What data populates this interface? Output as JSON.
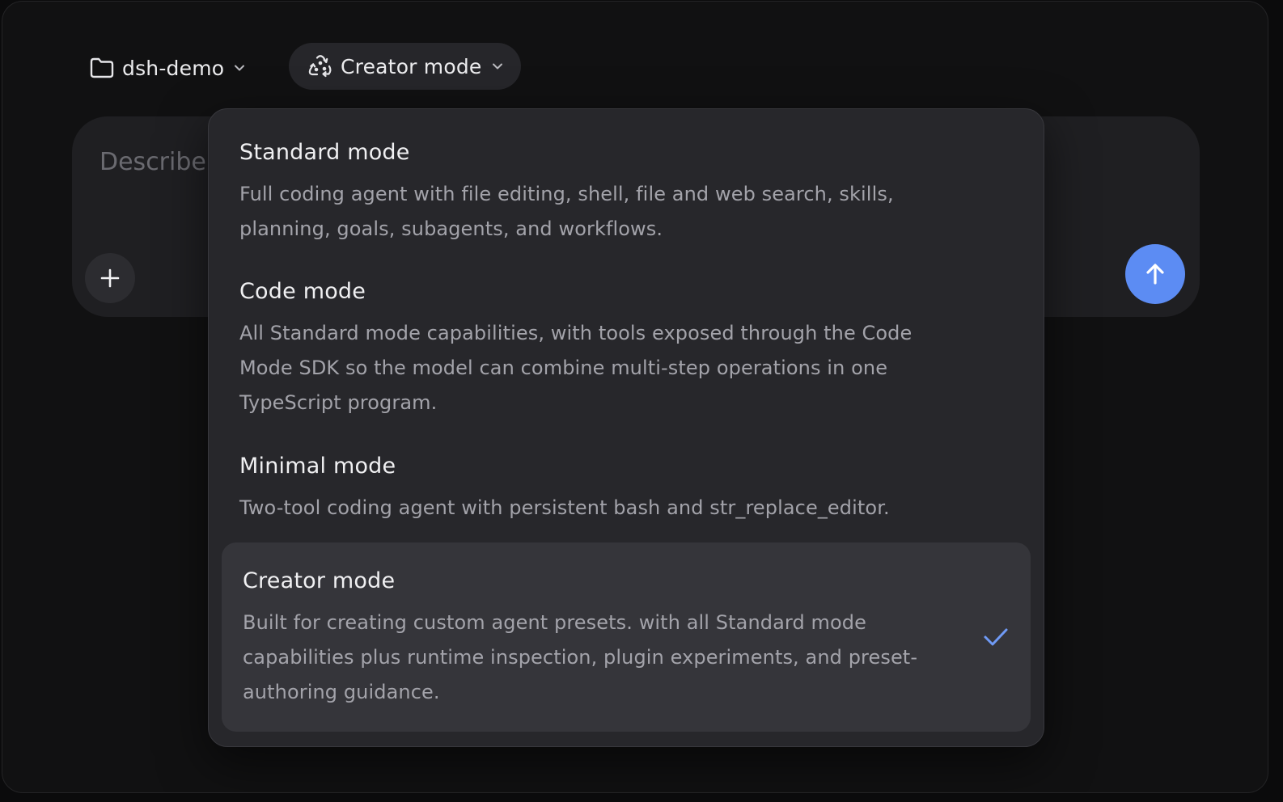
{
  "header": {
    "project_label": "dsh-demo",
    "project_icon": "folder-icon",
    "mode_label": "Creator mode",
    "mode_icon": "recycle-triangle-icon"
  },
  "composer": {
    "placeholder": "Describe",
    "add_icon": "plus-icon",
    "send_icon": "arrow-up-icon",
    "send_color": "#5c8cf3"
  },
  "mode_menu": {
    "options": [
      {
        "title": "Standard mode",
        "description": "Full coding agent with file editing, shell, file and web search, skills, planning, goals, subagents, and workflows.",
        "selected": false
      },
      {
        "title": "Code mode",
        "description": "All Standard mode capabilities, with tools exposed through the Code Mode SDK so the model can combine multi-step operations in one TypeScript program.",
        "selected": false
      },
      {
        "title": "Minimal mode",
        "description": "Two-tool coding agent with persistent bash and str_replace_editor.",
        "selected": false
      },
      {
        "title": "Creator mode",
        "description": "Built for creating custom agent presets. with all Standard mode capabilities plus runtime inspection, plugin experiments, and preset-authoring guidance.",
        "selected": true
      }
    ],
    "check_icon": "checkmark-icon",
    "check_color": "#6f9af5"
  }
}
